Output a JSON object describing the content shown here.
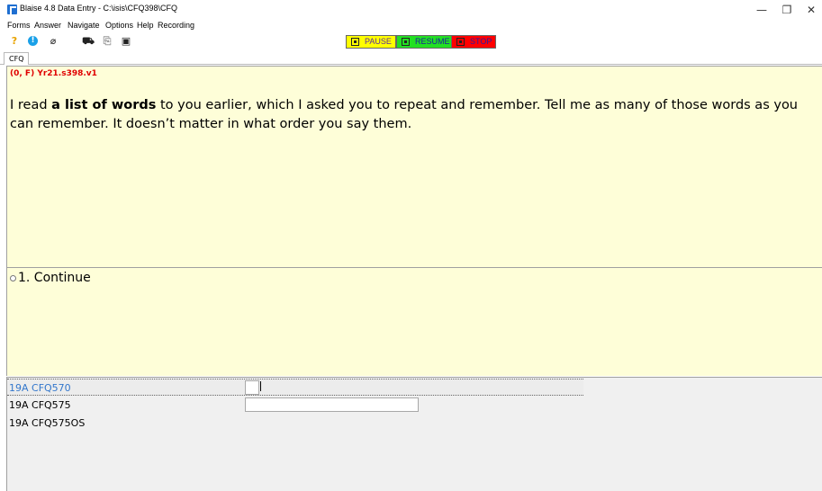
{
  "window": {
    "title": "Blaise 4.8 Data Entry - C:\\isis\\CFQ398\\CFQ",
    "minimize_glyph": "—",
    "restore_glyph": "❐",
    "close_glyph": "✕"
  },
  "menu": [
    "Forms",
    "Answer",
    "Navigate",
    "Options",
    "Help",
    "Recording"
  ],
  "toolbar": {
    "icons": [
      "help-question-icon",
      "info-alert-icon",
      "paperclip-icon",
      "find-icon",
      "copy-icon",
      "save-icon"
    ],
    "glyphs": [
      "?",
      "!",
      "⌀",
      "⛟",
      "⎘",
      "▣"
    ],
    "pause_label": "PAUSE",
    "resume_label": "RESUME",
    "stop_label": "STOP",
    "colors": {
      "pause": "#ffff00",
      "resume": "#00ee00",
      "stop": "#ff0000"
    }
  },
  "tab": {
    "label": "CFQ"
  },
  "question": {
    "id": "(0, F)  Yr21.s398.v1",
    "text_before": "I read ",
    "text_bold": "a list of words",
    "text_after": " to you earlier, which I asked you to repeat and remember. Tell me as many of those words as you can remember. It doesn’t matter in what order you say them."
  },
  "answer": {
    "option_label": "1. Continue"
  },
  "grid": {
    "rows": [
      {
        "name": "19A CFQ570",
        "color": "#3377cc",
        "value": ""
      },
      {
        "name": "19A CFQ575",
        "color": "#000000",
        "value": ""
      },
      {
        "name": "19A CFQ575OS",
        "color": "#000000",
        "value": ""
      }
    ]
  },
  "colors": {
    "question_bg": "#fefed8",
    "question_id": "#e00000",
    "grid_bg": "#f0f0f0"
  }
}
